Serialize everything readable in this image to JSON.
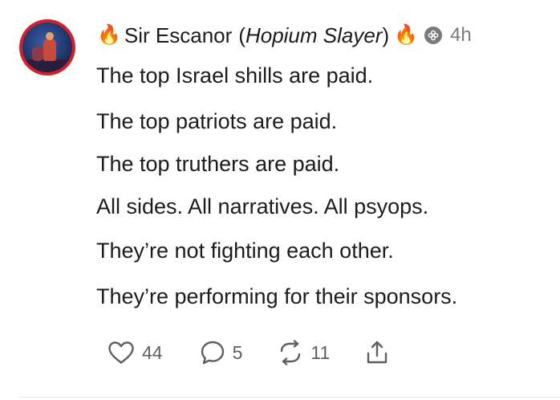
{
  "post": {
    "author": {
      "emoji_left": "🔥",
      "name": "Sir Escanor",
      "paren_open": "(",
      "title": "Hopium Slayer",
      "paren_close": ")",
      "emoji_right": "🔥",
      "badge_icon": "flower-badge-icon",
      "time": "4h"
    },
    "lines": [
      "The top Israel shills are paid.",
      "The top patriots are paid.",
      "The top truthers are paid.",
      "All sides. All narratives. All psyops.",
      "They’re not fighting each other.",
      "They’re performing for their sponsors."
    ],
    "actions": {
      "likes": "44",
      "comments": "5",
      "restacks": "11",
      "like_icon": "heart-icon",
      "comment_icon": "comment-bubble-icon",
      "restack_icon": "restack-arrows-icon",
      "share_icon": "share-icon"
    }
  },
  "colors": {
    "text": "#1c1c1e",
    "muted": "#7c7c80",
    "avatar_ring": "#d4202a",
    "divider": "#e3e3e6"
  }
}
